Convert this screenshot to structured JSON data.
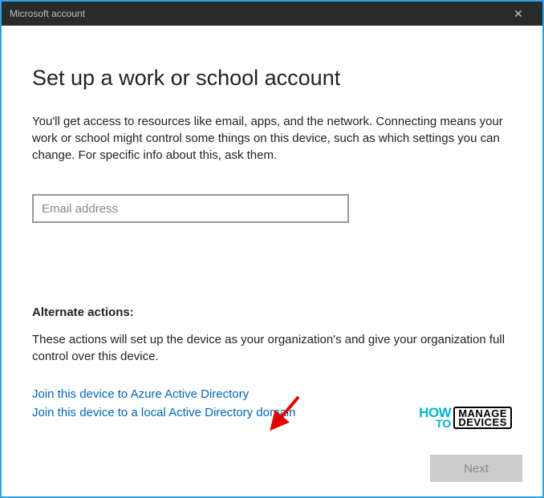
{
  "titlebar": {
    "title": "Microsoft account"
  },
  "main": {
    "heading": "Set up a work or school account",
    "description": "You'll get access to resources like email, apps, and the network. Connecting means your work or school might control some things on this device, such as which settings you can change. For specific info about this, ask them.",
    "email_placeholder": "Email address",
    "email_value": ""
  },
  "alternate": {
    "heading": "Alternate actions:",
    "description": "These actions will set up the device as your organization's and give your organization full control over this device.",
    "link_azure": "Join this device to Azure Active Directory",
    "link_domain": "Join this device to a local Active Directory domain"
  },
  "footer": {
    "next_label": "Next"
  },
  "watermark": {
    "how": "HOW",
    "to": "TO",
    "manage": "MANAGE",
    "devices": "DEVICES"
  }
}
